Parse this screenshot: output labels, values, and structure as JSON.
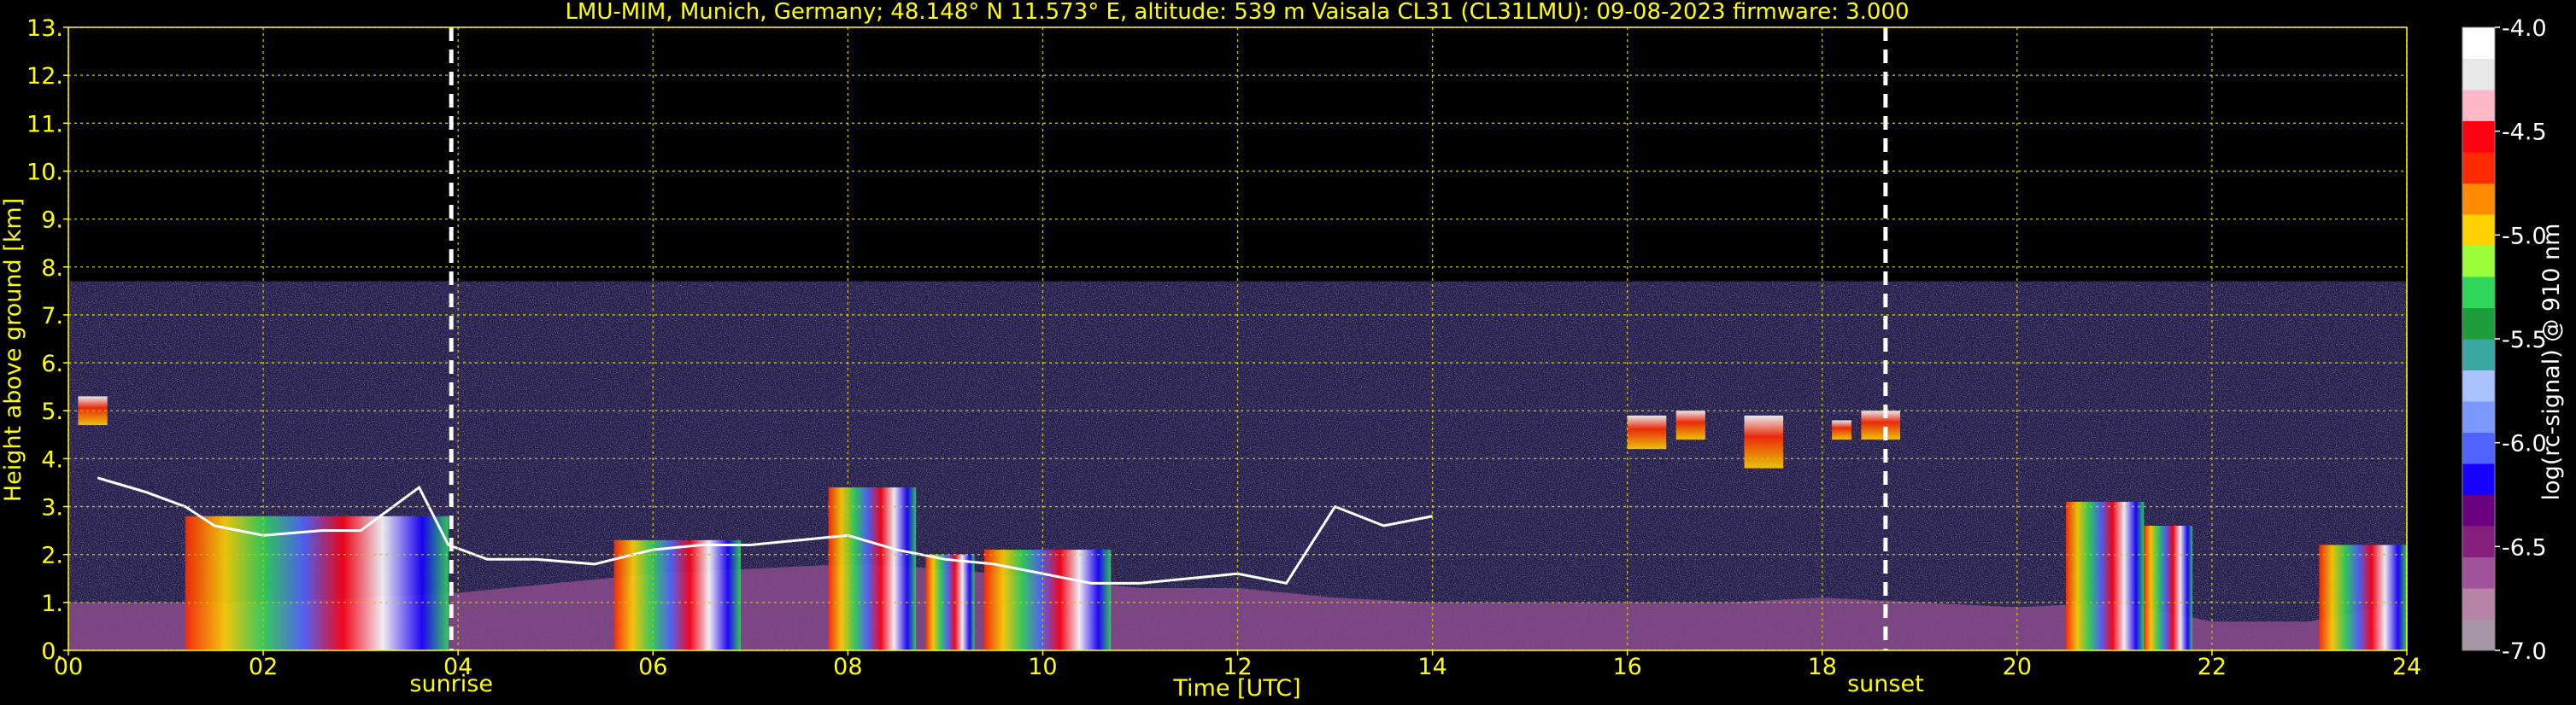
{
  "chart_data": {
    "type": "heatmap",
    "title": "LMU-MIM, Munich, Germany; 48.148° N 11.573° E, altitude: 539 m    Vaisala CL31 (CL31LMU): 09-08-2023    firmware: 3.000",
    "xlabel": "Time [UTC]",
    "ylabel": "Height above ground [km]",
    "xlim": [
      0,
      24
    ],
    "ylim": [
      0,
      13
    ],
    "x_ticks": [
      0,
      2,
      4,
      6,
      8,
      10,
      12,
      14,
      16,
      18,
      20,
      22,
      24
    ],
    "x_tick_labels": [
      "00",
      "02",
      "04",
      "06",
      "08",
      "10",
      "12",
      "14",
      "16",
      "18",
      "20",
      "22",
      "24"
    ],
    "y_ticks": [
      0,
      1,
      2,
      3,
      4,
      5,
      6,
      7,
      8,
      9,
      10,
      11,
      12,
      13
    ],
    "y_tick_labels": [
      "0.",
      "1.",
      "2.",
      "3.",
      "4.",
      "5.",
      "6.",
      "7.",
      "8.",
      "9.",
      "10.",
      "11.",
      "12.",
      "13."
    ],
    "grid": true,
    "grid_color": "#c8c800",
    "measurement_top_km": 7.7,
    "annotations": [
      {
        "x": 3.93,
        "label": "sunrise"
      },
      {
        "x": 18.65,
        "label": "sunset"
      }
    ],
    "colorbar": {
      "label": "log(rc-signal) @ 910 nm",
      "min": -7.0,
      "max": -4.0,
      "ticks": [
        -4.0,
        -4.5,
        -5.0,
        -5.5,
        -6.0,
        -6.5,
        -7.0
      ],
      "tick_labels": [
        "-4.0",
        "-4.5",
        "-5.0",
        "-5.5",
        "-6.0",
        "-6.5",
        "-7.0"
      ],
      "colors": [
        "#a895a6",
        "#b784a8",
        "#a0529a",
        "#86207c",
        "#6a0080",
        "#1600ff",
        "#4f64ff",
        "#7b98ff",
        "#a9c3ff",
        "#3aa8a0",
        "#1e9e3a",
        "#2ed65a",
        "#9cff3c",
        "#ffd200",
        "#ff8c00",
        "#ff2a00",
        "#ff0010",
        "#ffb8c8",
        "#e8e8e8",
        "#ffffff"
      ]
    },
    "cloud_base_series": {
      "name": "",
      "x": [
        0.3,
        0.8,
        1.2,
        1.5,
        2.0,
        2.6,
        3.0,
        3.6,
        3.9,
        4.3,
        4.8,
        5.4,
        6.0,
        6.5,
        7.0,
        7.5,
        8.0,
        8.5,
        9.0,
        9.5,
        10.0,
        10.5,
        11.0,
        11.5,
        12.0,
        12.5,
        13.0,
        13.5,
        14.0
      ],
      "values": [
        3.6,
        3.3,
        3.0,
        2.6,
        2.4,
        2.5,
        2.5,
        3.4,
        2.2,
        1.9,
        1.9,
        1.8,
        2.1,
        2.2,
        2.2,
        2.3,
        2.4,
        2.1,
        1.9,
        1.8,
        1.6,
        1.4,
        1.4,
        1.5,
        1.6,
        1.4,
        3.0,
        2.6,
        2.8
      ]
    },
    "boundary_layer_series": {
      "name": "",
      "x": [
        0,
        1,
        2,
        3,
        4,
        5,
        6,
        7,
        8,
        9,
        10,
        11,
        12,
        13,
        14,
        15,
        16,
        17,
        18,
        19,
        20,
        21,
        22,
        23,
        24
      ],
      "values": [
        1.0,
        1.0,
        1.0,
        1.1,
        1.2,
        1.4,
        1.6,
        1.7,
        1.8,
        1.7,
        1.5,
        1.3,
        1.3,
        1.1,
        1.0,
        1.0,
        1.0,
        1.0,
        1.1,
        1.0,
        0.9,
        1.0,
        0.6,
        0.6,
        1.0
      ]
    },
    "elevated_layers": [
      {
        "x_start": 0.1,
        "x_end": 0.4,
        "y_bottom": 4.7,
        "y_top": 5.3
      },
      {
        "x_start": 16.0,
        "x_end": 16.4,
        "y_bottom": 4.2,
        "y_top": 4.9
      },
      {
        "x_start": 16.5,
        "x_end": 16.8,
        "y_bottom": 4.4,
        "y_top": 5.0
      },
      {
        "x_start": 17.2,
        "x_end": 17.6,
        "y_bottom": 3.8,
        "y_top": 4.9
      },
      {
        "x_start": 18.1,
        "x_end": 18.3,
        "y_bottom": 4.4,
        "y_top": 4.8
      },
      {
        "x_start": 18.4,
        "x_end": 18.8,
        "y_bottom": 4.4,
        "y_top": 5.0
      }
    ],
    "intense_segments": [
      {
        "x_start": 1.2,
        "x_end": 3.9,
        "y_top": 2.8
      },
      {
        "x_start": 5.6,
        "x_end": 6.9,
        "y_top": 2.3
      },
      {
        "x_start": 7.8,
        "x_end": 8.7,
        "y_top": 3.4
      },
      {
        "x_start": 8.8,
        "x_end": 9.3,
        "y_top": 2.0
      },
      {
        "x_start": 9.4,
        "x_end": 10.7,
        "y_top": 2.1
      },
      {
        "x_start": 20.5,
        "x_end": 21.3,
        "y_top": 3.1
      },
      {
        "x_start": 21.3,
        "x_end": 21.8,
        "y_top": 2.6
      },
      {
        "x_start": 23.1,
        "x_end": 24.0,
        "y_top": 2.2
      }
    ]
  }
}
